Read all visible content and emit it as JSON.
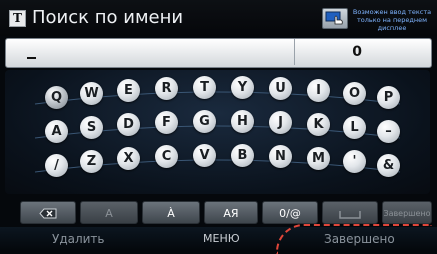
{
  "title_bar": {
    "title": "Поиск по имени",
    "title_icon_letter": "T",
    "input_mode_hint": "Возможен ввод текста только на переднем дисплее"
  },
  "input": {
    "value": "",
    "cursor_char": "_",
    "result_count": "0"
  },
  "keyboard": {
    "row1": [
      "Q",
      "W",
      "E",
      "R",
      "T",
      "Y",
      "U",
      "I",
      "O",
      "P"
    ],
    "row2": [
      "A",
      "S",
      "D",
      "F",
      "G",
      "H",
      "J",
      "K",
      "L",
      "–"
    ],
    "row3": [
      "/",
      "Z",
      "X",
      "C",
      "V",
      "B",
      "N",
      "M",
      "'",
      "&"
    ]
  },
  "function_row": {
    "backspace_label": "",
    "lowercase_label": "A",
    "accent_label": "À",
    "alphabet_toggle_label": "AЯ",
    "symbols_label": "0/@",
    "space_label": "",
    "done_label": "Завершено"
  },
  "bottom_bar": {
    "delete_label": "Удалить",
    "menu_label": "МЕНЮ",
    "done_label": "Завершено"
  },
  "colors": {
    "hint_text": "#7fb4ff",
    "highlight": "#e0463a"
  }
}
